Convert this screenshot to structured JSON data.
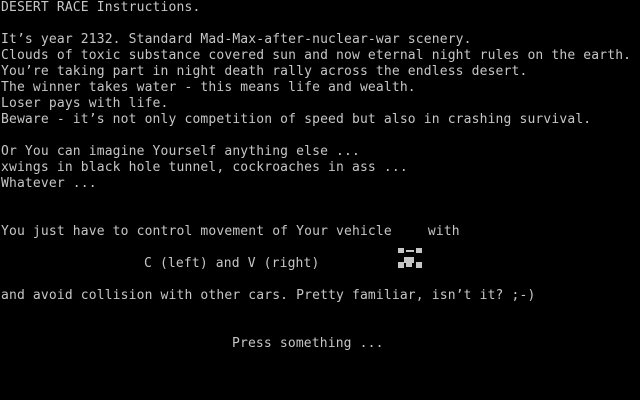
{
  "title": "DESERT RACE Instructions.",
  "story": [
    "It’s year 2132. Standard Mad-Max-after-nuclear-war scenery.",
    "Clouds of toxic substance covered sun and now eternal night rules on the earth.",
    "You’re taking part in night death rally across the endless desert.",
    "The winner takes water - this means life and wealth.",
    "Loser pays with life.",
    "Beware - it’s not only competition of speed but also in crashing survival."
  ],
  "imagine": [
    "Or You can imagine Yourself anything else ...",
    "xwings in black hole tunnel, cockroaches in ass ...",
    "Whatever ..."
  ],
  "control_before": "You just have to control movement of Your vehicle",
  "control_after": "with",
  "controls_keys": "C (left) and V (right)",
  "avoid": "and avoid collision with other cars. Pretty familiar, isn’t it? ;-)",
  "prompt": "Press something ...",
  "colors": {
    "background": "#000000",
    "text": "#c6c6c6",
    "vehicle": "#c6c6c6"
  },
  "icons": {
    "vehicle": "player-vehicle-icon"
  }
}
